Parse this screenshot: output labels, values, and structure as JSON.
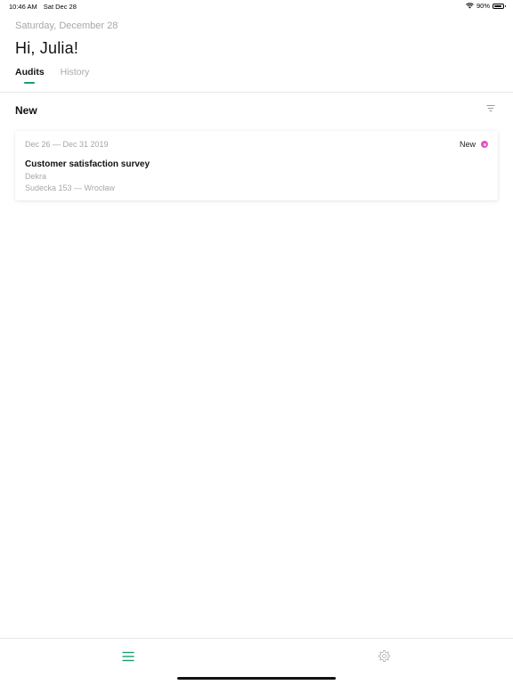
{
  "status_bar": {
    "time": "10:46 AM",
    "date": "Sat Dec 28",
    "battery_percent": "90%",
    "battery_level": 0.9
  },
  "header": {
    "date": "Saturday, December 28",
    "greeting": "Hi, Julia!"
  },
  "tabs": [
    {
      "label": "Audits",
      "active": true
    },
    {
      "label": "History",
      "active": false
    }
  ],
  "section": {
    "title": "New"
  },
  "audits": [
    {
      "dates": "Dec 26 — Dec 31 2019",
      "status": "New",
      "title": "Customer satisfaction survey",
      "company": "Dekra",
      "address": "Sudecka 153 — Wrocław"
    }
  ],
  "colors": {
    "accent": "#1b9a73",
    "status_new": "#e054c6",
    "muted_text": "#a7a7a7"
  },
  "icons": {
    "filter": "filter-icon",
    "nav_list": "list-icon",
    "nav_settings": "gear-icon",
    "wifi": "wifi-icon",
    "battery": "battery-icon"
  }
}
